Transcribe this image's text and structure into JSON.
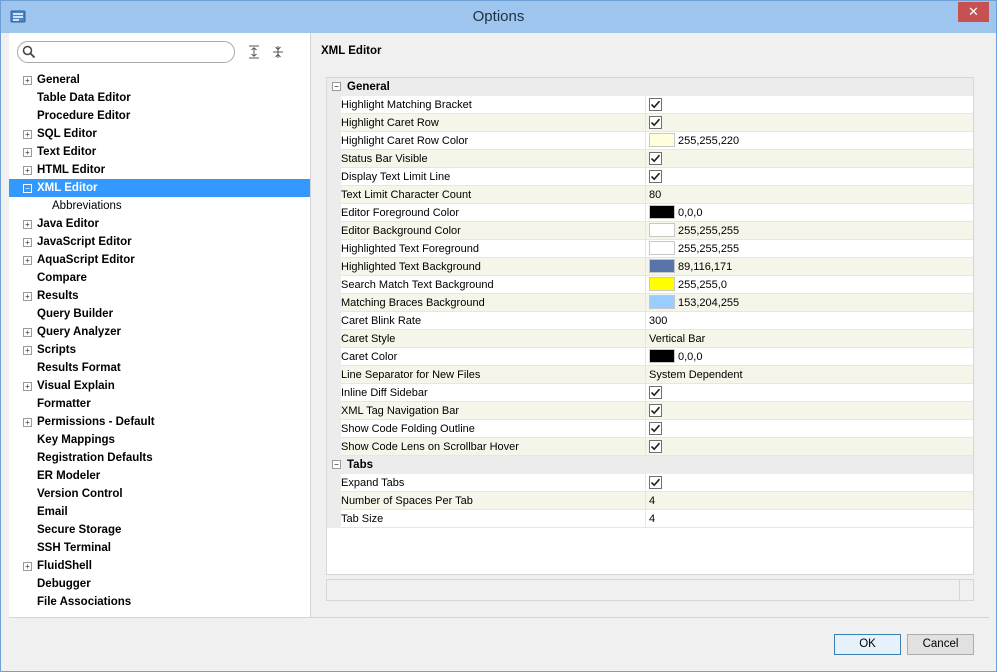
{
  "window": {
    "title": "Options",
    "close_label": "✕"
  },
  "search": {
    "placeholder": ""
  },
  "tree": [
    {
      "label": "General",
      "expander": "+"
    },
    {
      "label": "Table Data Editor",
      "expander": ""
    },
    {
      "label": "Procedure Editor",
      "expander": ""
    },
    {
      "label": "SQL Editor",
      "expander": "+"
    },
    {
      "label": "Text Editor",
      "expander": "+"
    },
    {
      "label": "HTML Editor",
      "expander": "+"
    },
    {
      "label": "XML Editor",
      "expander": "−",
      "selected": true
    },
    {
      "label": "Abbreviations",
      "expander": "",
      "child": true
    },
    {
      "label": "Java Editor",
      "expander": "+"
    },
    {
      "label": "JavaScript Editor",
      "expander": "+"
    },
    {
      "label": "AquaScript Editor",
      "expander": "+"
    },
    {
      "label": "Compare",
      "expander": ""
    },
    {
      "label": "Results",
      "expander": "+"
    },
    {
      "label": "Query Builder",
      "expander": ""
    },
    {
      "label": "Query Analyzer",
      "expander": "+"
    },
    {
      "label": "Scripts",
      "expander": "+"
    },
    {
      "label": "Results Format",
      "expander": ""
    },
    {
      "label": "Visual Explain",
      "expander": "+"
    },
    {
      "label": "Formatter",
      "expander": ""
    },
    {
      "label": "Permissions - Default",
      "expander": "+"
    },
    {
      "label": "Key Mappings",
      "expander": ""
    },
    {
      "label": "Registration Defaults",
      "expander": ""
    },
    {
      "label": "ER Modeler",
      "expander": ""
    },
    {
      "label": "Version Control",
      "expander": ""
    },
    {
      "label": "Email",
      "expander": ""
    },
    {
      "label": "Secure Storage",
      "expander": ""
    },
    {
      "label": "SSH Terminal",
      "expander": ""
    },
    {
      "label": "FluidShell",
      "expander": "+"
    },
    {
      "label": "Debugger",
      "expander": ""
    },
    {
      "label": "File Associations",
      "expander": ""
    }
  ],
  "panel": {
    "title": "XML Editor"
  },
  "grid": [
    {
      "category": "General"
    },
    {
      "name": "Highlight Matching Bracket",
      "type": "check",
      "checked": true
    },
    {
      "name": "Highlight Caret Row",
      "type": "check",
      "checked": true
    },
    {
      "name": "Highlight Caret Row Color",
      "type": "color",
      "color": "#ffffdc",
      "value": "255,255,220"
    },
    {
      "name": "Status Bar Visible",
      "type": "check",
      "checked": true
    },
    {
      "name": "Display Text Limit Line",
      "type": "check",
      "checked": true
    },
    {
      "name": "Text Limit Character Count",
      "type": "text",
      "value": "80"
    },
    {
      "name": "Editor Foreground Color",
      "type": "color",
      "color": "#000000",
      "value": "0,0,0"
    },
    {
      "name": "Editor Background Color",
      "type": "color",
      "color": "#ffffff",
      "value": "255,255,255"
    },
    {
      "name": "Highlighted Text Foreground",
      "type": "color",
      "color": "#ffffff",
      "value": "255,255,255"
    },
    {
      "name": "Highlighted Text Background",
      "type": "color",
      "color": "#5974ab",
      "value": "89,116,171"
    },
    {
      "name": "Search Match Text Background",
      "type": "color",
      "color": "#ffff00",
      "value": "255,255,0"
    },
    {
      "name": "Matching Braces Background",
      "type": "color",
      "color": "#99ccff",
      "value": "153,204,255"
    },
    {
      "name": "Caret Blink Rate",
      "type": "text",
      "value": "300"
    },
    {
      "name": "Caret Style",
      "type": "text",
      "value": "Vertical Bar"
    },
    {
      "name": "Caret Color",
      "type": "color",
      "color": "#000000",
      "value": "0,0,0"
    },
    {
      "name": "Line Separator for New Files",
      "type": "text",
      "value": "System Dependent"
    },
    {
      "name": "Inline Diff Sidebar",
      "type": "check",
      "checked": true
    },
    {
      "name": "XML Tag Navigation Bar",
      "type": "check",
      "checked": true
    },
    {
      "name": "Show Code Folding Outline",
      "type": "check",
      "checked": true
    },
    {
      "name": "Show Code Lens on Scrollbar Hover",
      "type": "check",
      "checked": true
    },
    {
      "category": "Tabs"
    },
    {
      "name": "Expand Tabs",
      "type": "check",
      "checked": true
    },
    {
      "name": "Number of Spaces Per Tab",
      "type": "text",
      "value": "4"
    },
    {
      "name": "Tab Size",
      "type": "text",
      "value": "4"
    }
  ],
  "buttons": {
    "ok": "OK",
    "cancel": "Cancel"
  },
  "colors": {
    "selection": "#3399ff",
    "titlebar": "#9ec5ee",
    "close": "#c75050"
  }
}
